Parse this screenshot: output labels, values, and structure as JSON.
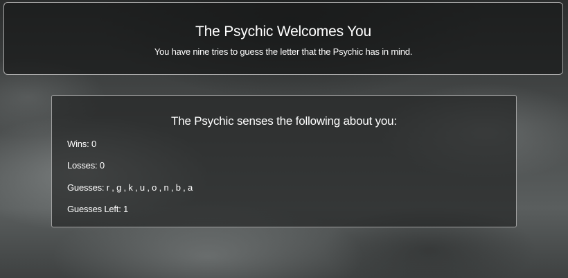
{
  "header": {
    "title": "The Psychic Welcomes You",
    "subtitle": "You have nine tries to guess the letter that the Psychic has in mind."
  },
  "stats": {
    "heading": "The Psychic senses the following about you:",
    "wins_label": "Wins:",
    "wins": "0",
    "losses_label": "Losses:",
    "losses": "0",
    "guesses_label": "Guesses:",
    "guesses": "r , g , k , u , o , n , b , a",
    "guesses_left_label": "Guesses Left:",
    "guesses_left": "1"
  }
}
